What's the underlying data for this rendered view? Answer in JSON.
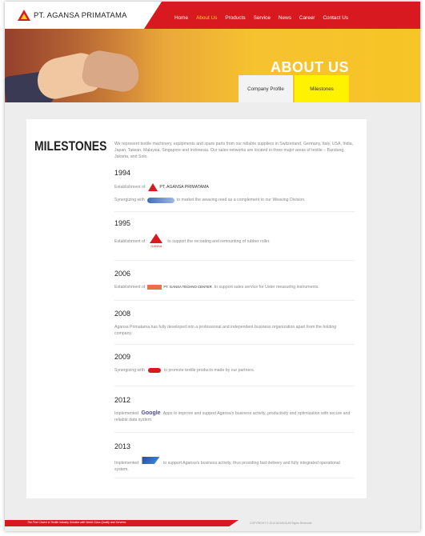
{
  "brand": {
    "name": "PT. AGANSA PRIMATAMA"
  },
  "nav": {
    "items": [
      "Home",
      "About Us",
      "Products",
      "Service",
      "News",
      "Career",
      "Contact Us"
    ],
    "active": "About Us"
  },
  "banner": {
    "title": "ABOUT US",
    "tabs": [
      "Company Profile",
      "Milestones"
    ],
    "active_tab": "Milestones"
  },
  "content": {
    "heading": "MILESTONES",
    "intro": "We represent textile machinery, equipments and spare parts from our reliable suppliers in Switzerland, Germany, Italy, USA, India, Japan, Taiwan, Malaysia, Singapore and Indonesia. Our sales networks are located in three major areas of textile – Bandung, Jakarta, and Solo.",
    "milestones": [
      {
        "year": "1994",
        "l1_pre": "Establishment of",
        "l1_logo": "PT. AGANSA PRIMATAMA",
        "l2_pre": "Synergizing with",
        "l2_post": "to market the weaving reed as a complement to our Weaving Division."
      },
      {
        "year": "1995",
        "pre": "Establishment of",
        "logo": "GANSA",
        "post": "to support the recoating and remounting of rubber roller."
      },
      {
        "year": "2006",
        "pre": "Establishment of",
        "logo": "PT. GANSA TECHNO CENTER",
        "post": "to support sales service for Uster measuring instruments."
      },
      {
        "year": "2008",
        "text": "Agansa Primatama has fully developed into a professional and independent business organization apart from the holding company."
      },
      {
        "year": "2009",
        "pre": "Synergizing with",
        "logo": "PTS",
        "post": "to promote textile products made by our partners."
      },
      {
        "year": "2012",
        "pre": "Implemented",
        "logo": "Google",
        "post": "Apps to improve and support Agansa's business activity, productivity and optimization with secure and reliable data system."
      },
      {
        "year": "2013",
        "pre": "Implemented",
        "logo": "SAP",
        "post": "to support Agansa's business activity, thus providing fast delivery and fully integrated operational system."
      }
    ]
  },
  "footer": {
    "tagline": "The First Choice in Textile Industry Solution with World Class Quality and Services",
    "copyright": "COPYRIGHT © 2013 AGANSA All Rights Reserved."
  },
  "colors": {
    "brand_red": "#d8191f",
    "active_nav": "#ffd21a",
    "tab_highlight": "#fff200"
  }
}
